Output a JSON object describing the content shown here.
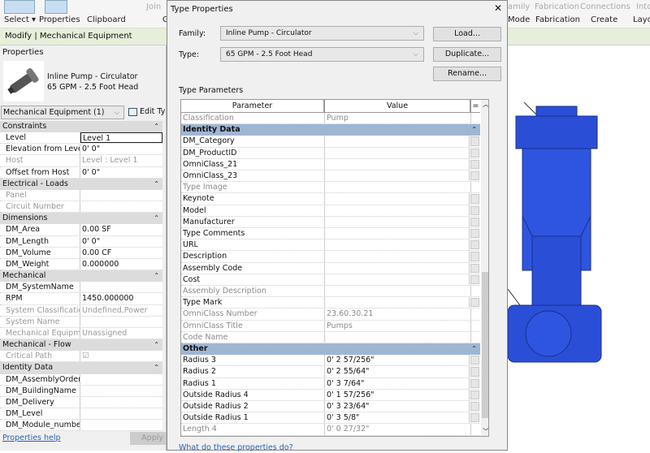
{
  "ribbon": {
    "select": "Select ▾",
    "properties": "Properties",
    "clipboard": "Clipboard",
    "join": "Join",
    "geometry": "Ge",
    "family": "amily",
    "design_fab": "Fabrication",
    "connections": "Connections",
    "into": "Into",
    "mode": "Mode",
    "fabrication": "Fabrication",
    "create": "Create",
    "layout": "Layo"
  },
  "context_bar": "Modify | Mechanical Equipment",
  "properties_panel": {
    "title": "Properties",
    "family_name": "Inline Pump - Circulator",
    "type_name": "65 GPM - 2.5 Foot Head",
    "category_selector": "Mechanical Equipment (1)",
    "edit_type": "Edit Ty",
    "help_link": "Properties help",
    "apply": "Apply",
    "rows": [
      {
        "h": "Constraints"
      },
      {
        "k": "Level",
        "v": "Level 1",
        "edit": true
      },
      {
        "k": "Elevation from Level",
        "v": "0'  0\""
      },
      {
        "k": "Host",
        "v": "Level : Level 1",
        "dis": true
      },
      {
        "k": "Offset from Host",
        "v": "0'  0\""
      },
      {
        "h": "Electrical - Loads"
      },
      {
        "k": "Panel",
        "v": "",
        "dis": true
      },
      {
        "k": "Circuit Number",
        "v": "",
        "dis": true
      },
      {
        "h": "Dimensions"
      },
      {
        "k": "DM_Area",
        "v": "0.00 SF"
      },
      {
        "k": "DM_Length",
        "v": "0'  0\""
      },
      {
        "k": "DM_Volume",
        "v": "0.00 CF"
      },
      {
        "k": "DM_Weight",
        "v": "0.000000"
      },
      {
        "h": "Mechanical"
      },
      {
        "k": "DM_SystemName",
        "v": ""
      },
      {
        "k": "RPM",
        "v": "1450.000000"
      },
      {
        "k": "System Classification",
        "v": "Undefined,Power",
        "dis": true
      },
      {
        "k": "System Name",
        "v": "",
        "dis": true
      },
      {
        "k": "Mechanical Equipm...",
        "v": "Unassigned",
        "dis": true
      },
      {
        "h": "Mechanical - Flow"
      },
      {
        "k": "Critical Path",
        "v": "☑",
        "dis": true
      },
      {
        "h": "Identity Data"
      },
      {
        "k": "DM_AssemblyOrder",
        "v": ""
      },
      {
        "k": "DM_BuildingName",
        "v": ""
      },
      {
        "k": "DM_Delivery",
        "v": ""
      },
      {
        "k": "DM_Level",
        "v": ""
      },
      {
        "k": "DM_Module_number",
        "v": ""
      }
    ]
  },
  "dialog": {
    "title": "Type Properties",
    "close": "✕",
    "family_label": "Family:",
    "family_value": "Inline Pump - Circulator",
    "type_label": "Type:",
    "type_value": "65 GPM - 2.5 Foot Head",
    "load": "Load...",
    "duplicate": "Duplicate...",
    "rename": "Rename...",
    "section_label": "Type Parameters",
    "col_parameter": "Parameter",
    "col_value": "Value",
    "col_eq": "=",
    "help_link": "What do these properties do?",
    "rows": [
      {
        "k": "Classification",
        "v": "Pump",
        "dis": true
      },
      {
        "h": "Identity Data"
      },
      {
        "k": "DM_Category",
        "v": ""
      },
      {
        "k": "DM_ProductID",
        "v": ""
      },
      {
        "k": "OmniClass_21",
        "v": ""
      },
      {
        "k": "OmniClass_23",
        "v": ""
      },
      {
        "k": "Type Image",
        "v": "",
        "dis": true
      },
      {
        "k": "Keynote",
        "v": ""
      },
      {
        "k": "Model",
        "v": ""
      },
      {
        "k": "Manufacturer",
        "v": ""
      },
      {
        "k": "Type Comments",
        "v": ""
      },
      {
        "k": "URL",
        "v": ""
      },
      {
        "k": "Description",
        "v": ""
      },
      {
        "k": "Assembly Code",
        "v": ""
      },
      {
        "k": "Cost",
        "v": ""
      },
      {
        "k": "Assembly Description",
        "v": "",
        "dis": true
      },
      {
        "k": "Type Mark",
        "v": ""
      },
      {
        "k": "OmniClass Number",
        "v": "23.60.30.21",
        "dis": true
      },
      {
        "k": "OmniClass Title",
        "v": "Pumps",
        "dis": true
      },
      {
        "k": "Code Name",
        "v": "",
        "dis": true
      },
      {
        "h": "Other"
      },
      {
        "k": "Radius 3",
        "v": "0'  2 57/256\""
      },
      {
        "k": "Radius 2",
        "v": "0'  2 55/64\""
      },
      {
        "k": "Radius 1",
        "v": "0'  3 7/64\""
      },
      {
        "k": "Outside Radius 4",
        "v": "0'  1 57/256\""
      },
      {
        "k": "Outside Radius 2",
        "v": "0'  3 23/64\""
      },
      {
        "k": "Outside Radius 1",
        "v": "0'  3 5/8\""
      },
      {
        "k": "Length 4",
        "v": "0'  0 27/32\"",
        "dis": true
      }
    ]
  },
  "colors": {
    "section_header": "#9fb6d3",
    "context_bar": "#e6efd9",
    "pump_blue": "#2a4fd6"
  }
}
